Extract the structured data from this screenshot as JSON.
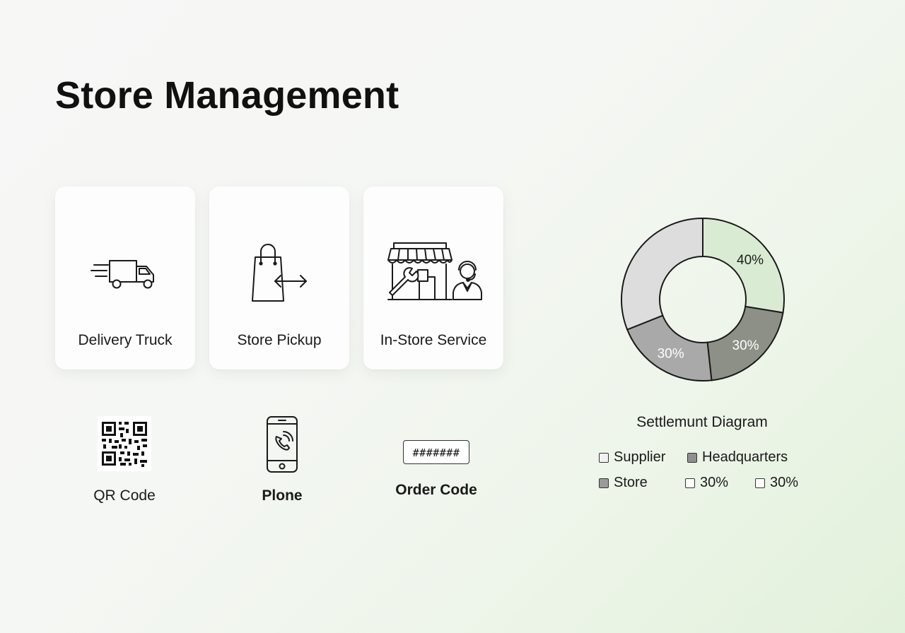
{
  "page": {
    "title": "Store Management"
  },
  "cards": [
    {
      "label": "Delivery Truck",
      "icon": "delivery-truck-icon"
    },
    {
      "label": "Store Pickup",
      "icon": "shopping-bag-exchange-icon"
    },
    {
      "label": "In-Store Service",
      "icon": "storefront-service-icon"
    }
  ],
  "tools": {
    "qr": {
      "label": "QR Code",
      "icon": "qr-code-icon"
    },
    "phone": {
      "label": "Plone",
      "icon": "phone-icon"
    },
    "order": {
      "label": "Order Code",
      "value": "#######",
      "icon": "order-code-field"
    }
  },
  "chart_data": {
    "type": "pie",
    "title": "Settlemunt Diagram",
    "slices": [
      {
        "label": "40%",
        "value": 40,
        "color": "#d9ecd3"
      },
      {
        "label": "30%",
        "value": 30,
        "color": "#8c9086"
      },
      {
        "label": "30%",
        "value": 30,
        "color": "#a9a9a9"
      },
      {
        "label": "",
        "value": 45,
        "color": "#dddddd"
      }
    ],
    "legend": [
      {
        "label": "Supplier",
        "color": "#f2f2f2"
      },
      {
        "label": "Headquarters",
        "color": "#8f8f8f"
      },
      {
        "label": "Store",
        "color": "#9a9a9a"
      },
      {
        "label": "30%",
        "color": "#ffffff"
      },
      {
        "label": "30%",
        "color": "#ffffff"
      }
    ]
  }
}
